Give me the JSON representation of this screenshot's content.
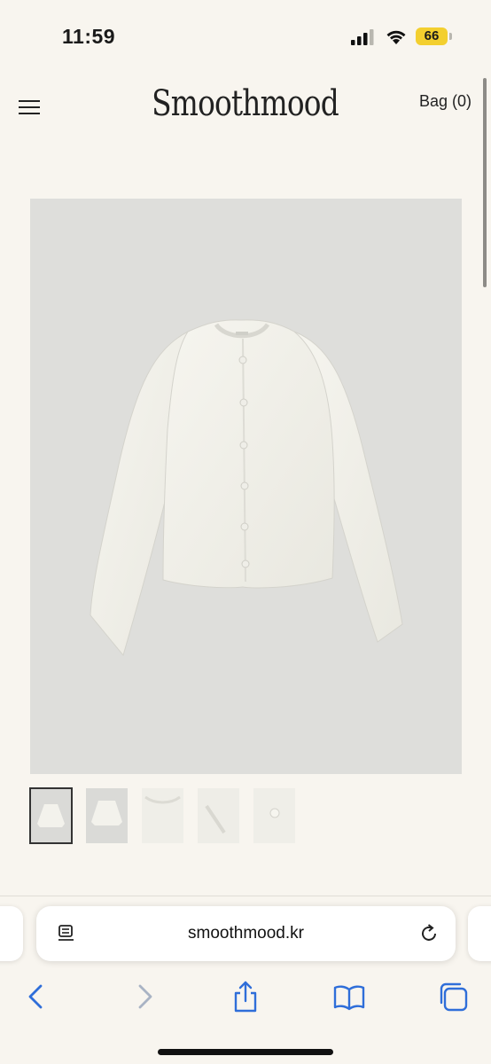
{
  "status_bar": {
    "time": "11:59",
    "battery": "66",
    "battery_color": "#f3cf2f"
  },
  "header": {
    "logo": "Smoothmood",
    "bag_link": "Bag (0)",
    "menu_icon": "hamburger-menu-icon"
  },
  "product": {
    "main_image": "white-knit-cardigan",
    "thumbnails": [
      {
        "name": "front-view",
        "active": true
      },
      {
        "name": "back-view",
        "active": false
      },
      {
        "name": "collar-detail",
        "active": false
      },
      {
        "name": "sleeve-detail",
        "active": false
      },
      {
        "name": "button-detail",
        "active": false
      }
    ]
  },
  "browser": {
    "url": "smoothmood.kr",
    "reader_icon": "page-menu-icon",
    "reload_icon": "reload-icon",
    "toolbar": [
      "back-icon",
      "forward-icon",
      "share-icon",
      "bookmarks-icon",
      "tabs-icon"
    ]
  }
}
